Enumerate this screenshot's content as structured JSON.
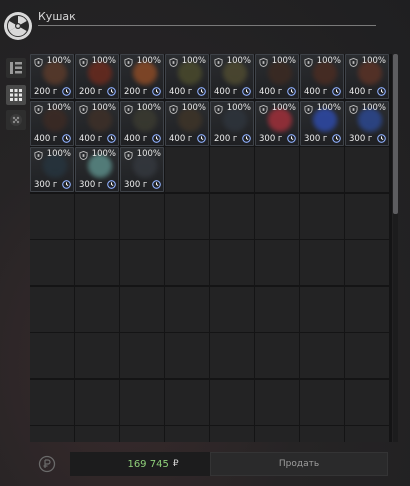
{
  "header": {
    "title": "Кушак"
  },
  "sidebar": {
    "tabs": [
      {
        "name": "list-view",
        "icon": "list-view-icon",
        "active": false
      },
      {
        "name": "grid-view",
        "icon": "grid-view-icon",
        "active": true
      },
      {
        "name": "misc",
        "icon": "dots-icon",
        "active": false
      }
    ]
  },
  "inventory": {
    "items": [
      {
        "durability": "100%",
        "price": "200 г",
        "color": "#5a3a2a"
      },
      {
        "durability": "100%",
        "price": "200 г",
        "color": "#6a2a1e"
      },
      {
        "durability": "100%",
        "price": "200 г",
        "color": "#8a4a26"
      },
      {
        "durability": "100%",
        "price": "400 г",
        "color": "#4a4a2c"
      },
      {
        "durability": "100%",
        "price": "400 г",
        "color": "#4e4a30"
      },
      {
        "durability": "100%",
        "price": "400 г",
        "color": "#3c2a22"
      },
      {
        "durability": "100%",
        "price": "400 г",
        "color": "#4a2c22"
      },
      {
        "durability": "100%",
        "price": "400 г",
        "color": "#5a3226"
      },
      {
        "durability": "100%",
        "price": "400 г",
        "color": "#3c2a24"
      },
      {
        "durability": "100%",
        "price": "400 г",
        "color": "#3e3028"
      },
      {
        "durability": "100%",
        "price": "400 г",
        "color": "#3a3a30"
      },
      {
        "durability": "100%",
        "price": "400 г",
        "color": "#3e3428"
      },
      {
        "durability": "100%",
        "price": "200 г",
        "color": "#2e343c"
      },
      {
        "durability": "100%",
        "price": "300 г",
        "color": "#a0303a"
      },
      {
        "durability": "100%",
        "price": "300 г",
        "color": "#2e4aa8"
      },
      {
        "durability": "100%",
        "price": "300 г",
        "color": "#2c4890"
      },
      {
        "durability": "100%",
        "price": "300 г",
        "color": "#26343e"
      },
      {
        "durability": "100%",
        "price": "300 г",
        "color": "#5a8a86"
      },
      {
        "durability": "100%",
        "price": "300 г",
        "color": "#34383e"
      }
    ]
  },
  "footer": {
    "balance": "169 745",
    "currency": "₽",
    "sell_label": "Продать"
  },
  "colors": {
    "accent_green": "#8fd07a",
    "item_border": "#3e4248"
  }
}
